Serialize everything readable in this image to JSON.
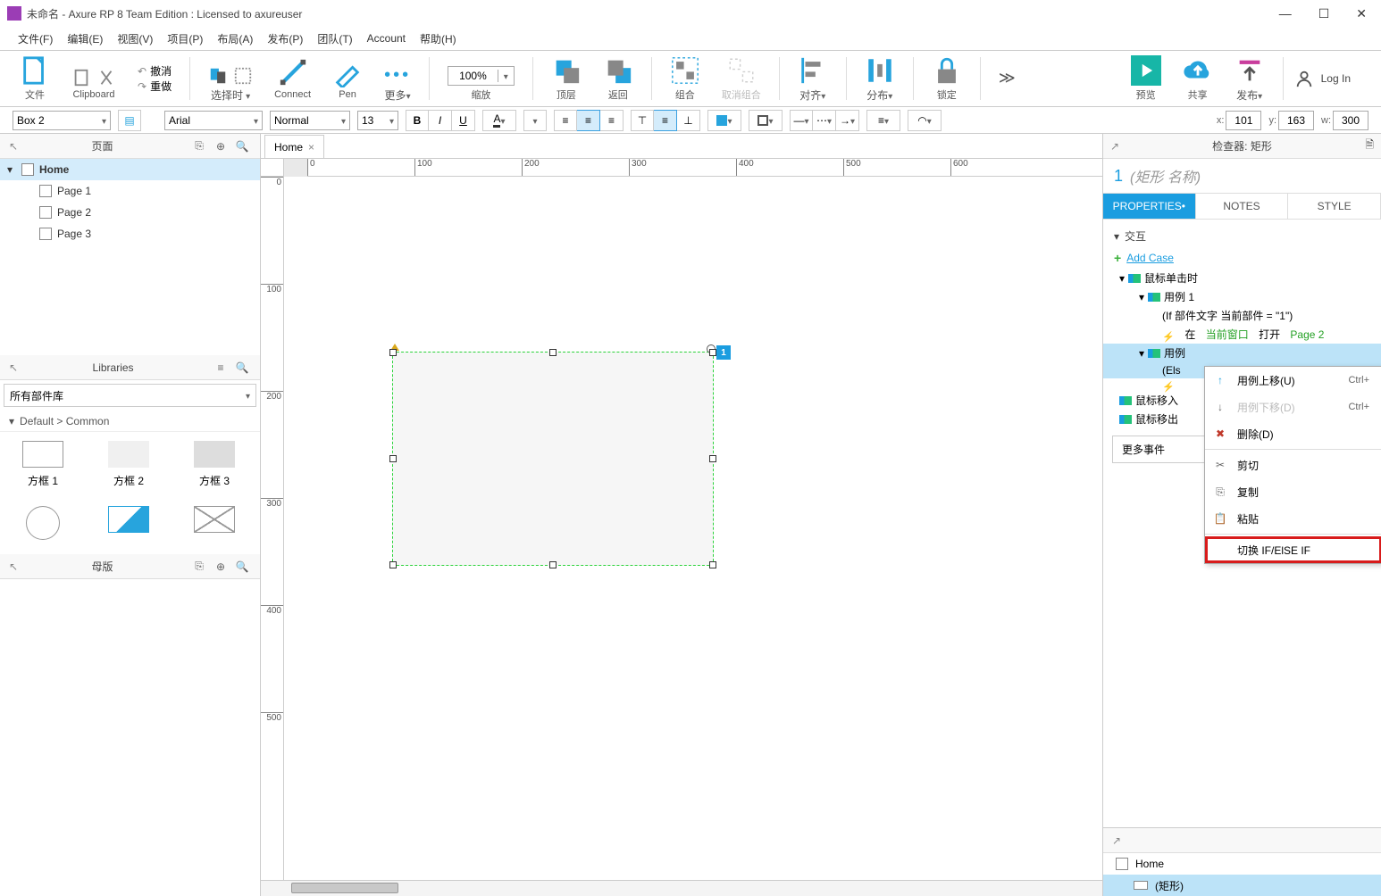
{
  "titlebar": {
    "title": "未命名 - Axure RP 8 Team Edition : Licensed to axureuser"
  },
  "menubar": [
    "文件(F)",
    "编辑(E)",
    "视图(V)",
    "项目(P)",
    "布局(A)",
    "发布(P)",
    "团队(T)",
    "Account",
    "帮助(H)"
  ],
  "toolbar": {
    "file": "文件",
    "clipboard": "Clipboard",
    "undo": "撤消",
    "redo": "重做",
    "select_mode": "选择时",
    "connect": "Connect",
    "pen": "Pen",
    "more": "更多",
    "zoom_value": "100%",
    "zoom_label": "缩放",
    "front": "顶层",
    "back": "返回",
    "group": "组合",
    "ungroup": "取消组合",
    "align": "对齐",
    "distribute": "分布",
    "lock": "锁定",
    "preview": "预览",
    "share": "共享",
    "publish": "发布",
    "login": "Log In"
  },
  "formatbar": {
    "widget_style": "Box 2",
    "font": "Arial",
    "weight": "Normal",
    "size": "13",
    "x_label": "x:",
    "x_value": "101",
    "y_label": "y:",
    "y_value": "163",
    "w_label": "w:",
    "w_value": "300"
  },
  "pages_pane": {
    "title": "页面",
    "items": [
      {
        "name": "Home",
        "selected": true,
        "children": [
          "Page 1",
          "Page 2",
          "Page 3"
        ]
      }
    ]
  },
  "libraries_pane": {
    "title": "Libraries",
    "dropdown": "所有部件库",
    "breadcrumb": "Default > Common",
    "items": [
      "方框 1",
      "方框 2",
      "方框 3",
      "",
      "",
      ""
    ]
  },
  "masters_pane": {
    "title": "母版"
  },
  "canvas": {
    "tab": "Home",
    "ruler_marks_h": [
      "0",
      "100",
      "200",
      "300",
      "400",
      "500",
      "600"
    ],
    "ruler_marks_v": [
      "0",
      "100",
      "200",
      "300",
      "400",
      "500"
    ],
    "shape_footnote": "1"
  },
  "inspector": {
    "header": "检查器: 矩形",
    "shape_index": "1",
    "shape_name_placeholder": "(矩形 名称)",
    "tabs": {
      "properties": "PROPERTIES",
      "notes": "NOTES",
      "style": "STYLE"
    },
    "ix_header": "交互",
    "add_case": "Add Case",
    "event_click": "鼠标单击时",
    "case1": "用例 1",
    "case1_cond": "(If 部件文字 当前部件 = \"1\")",
    "case1_action_prefix": "在",
    "case1_action_mid": "当前窗口",
    "case1_action_suffix": "打开",
    "case1_action_link": "Page 2",
    "case2": "用例",
    "case2_cond": "(Els",
    "event_mousein": "鼠标移入",
    "event_mouseout": "鼠标移出",
    "more_events": "更多事件"
  },
  "outline": {
    "home": "Home",
    "shape": "(矩形)"
  },
  "context_menu": {
    "move_up": "用例上移(U)",
    "move_up_key": "Ctrl+",
    "move_down": "用例下移(D)",
    "move_down_key": "Ctrl+",
    "delete": "删除(D)",
    "cut": "剪切",
    "copy": "复制",
    "paste": "粘贴",
    "toggle_if": "切换 IF/ElSE IF"
  }
}
